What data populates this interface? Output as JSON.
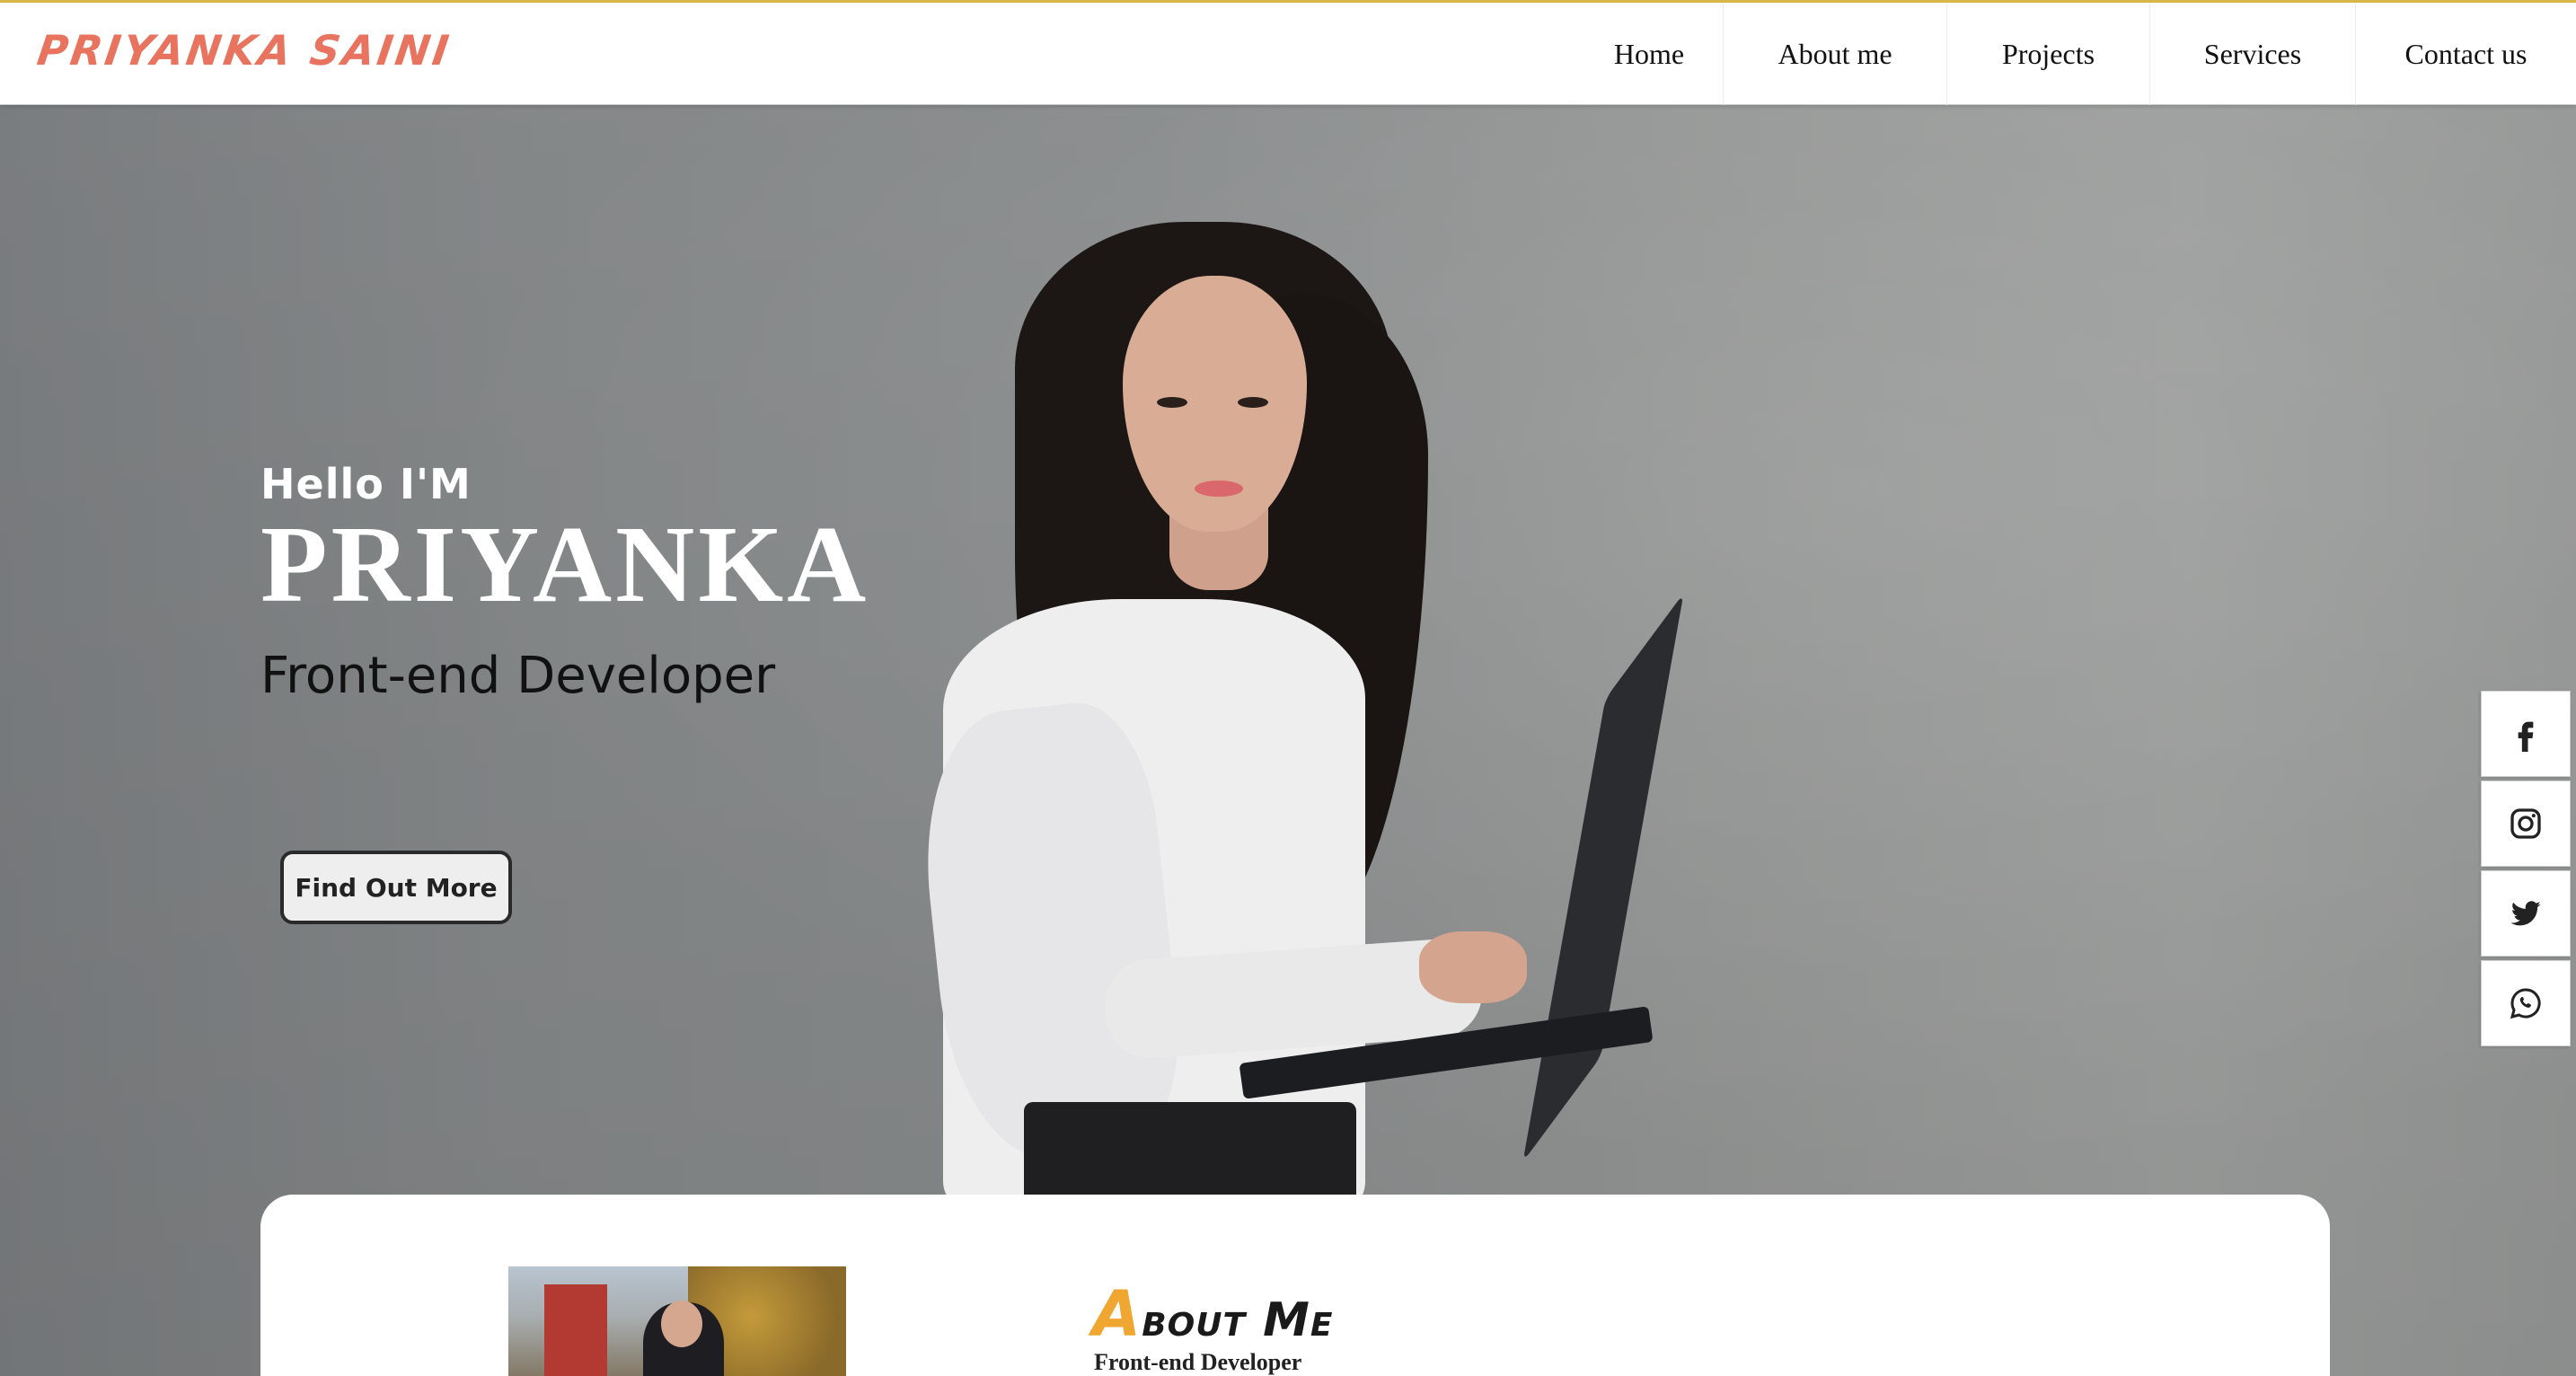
{
  "brand": {
    "logo_text": "Priyanka Saini",
    "accent_color": "#e8735e"
  },
  "nav": {
    "home": "Home",
    "about": "About me",
    "projects": "Projects",
    "services": "Services",
    "contact": "Contact us"
  },
  "hero": {
    "greeting": "Hello I'M",
    "name": "PRIYANKA",
    "role": "Front-end Developer",
    "cta_label": "Find Out More"
  },
  "social": {
    "items": [
      {
        "icon": "facebook-icon"
      },
      {
        "icon": "instagram-icon"
      },
      {
        "icon": "twitter-icon"
      },
      {
        "icon": "whatsapp-icon"
      }
    ]
  },
  "about": {
    "title_first": "A",
    "title_rest": "bout Me",
    "title_accent_color": "#f0a732",
    "subtitle": "Front-end Developer"
  }
}
